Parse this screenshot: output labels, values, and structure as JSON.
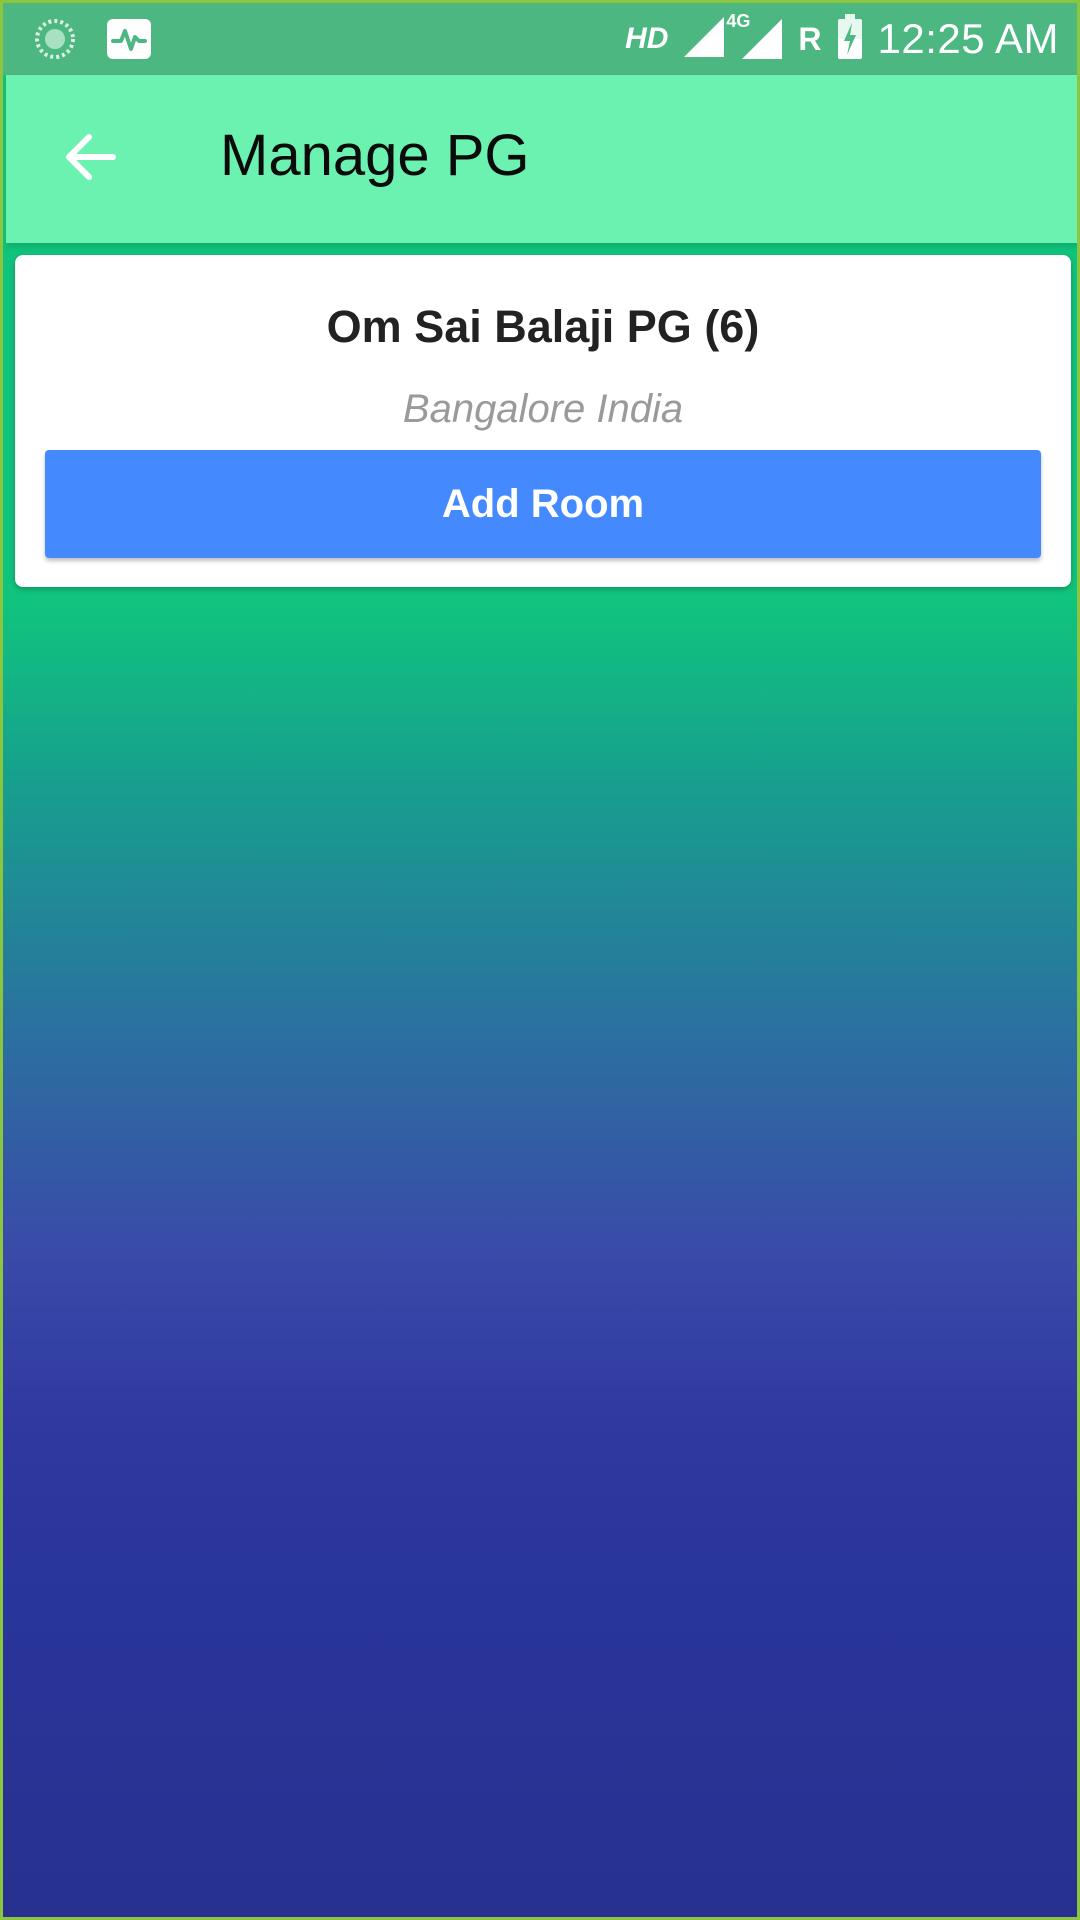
{
  "status_bar": {
    "icons_left": [
      "loading-circle-icon",
      "activity-monitor-icon"
    ],
    "network_label": "HD",
    "network_type": "4G",
    "roaming": "R",
    "time": "12:25 AM",
    "colors": {
      "background": "#4db782",
      "foreground": "#ffffff"
    }
  },
  "app_bar": {
    "title": "Manage PG",
    "back_icon": "arrow-left-icon",
    "background": "#6bf2b0"
  },
  "pg_card": {
    "name": "Om Sai Balaji PG (6)",
    "location": "Bangalore India",
    "add_room_label": "Add Room",
    "button_color": "#4589ff"
  },
  "background_gradient": [
    "#10c47d",
    "#2a72a0",
    "#3a4aa9",
    "#27318f"
  ]
}
